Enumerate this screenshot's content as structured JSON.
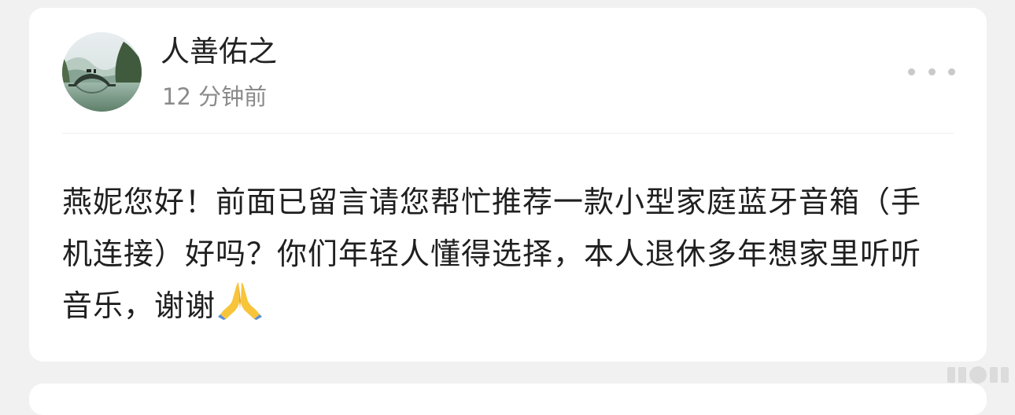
{
  "post": {
    "author": "人善佑之",
    "time": "12 分钟前",
    "content": "燕妮您好！前面已留言请您帮忙推荐一款小型家庭蓝牙音箱（手机连接）好吗？你们年轻人懂得选择，本人退休多年想家里听听音乐，谢谢",
    "emoji": "praying-hands-icon",
    "more_icon": "more-horizontal-icon",
    "avatar_icon": "avatar-landscape"
  },
  "colors": {
    "page_bg": "#f1f1f1",
    "card_bg": "#ffffff",
    "text_primary": "#222222",
    "text_secondary": "#8a8a8a"
  }
}
